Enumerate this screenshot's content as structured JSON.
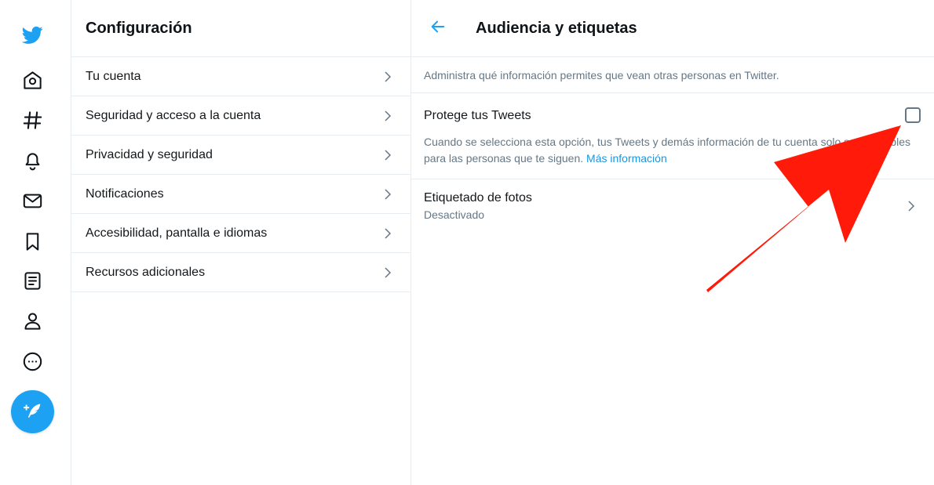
{
  "nav": {
    "icons": [
      "twitter-bird-icon",
      "home-icon",
      "explore-hashtag-icon",
      "notifications-bell-icon",
      "messages-envelope-icon",
      "bookmarks-icon",
      "lists-icon",
      "profile-person-icon",
      "more-options-icon"
    ],
    "tweet_button_icon": "compose-feather-icon",
    "brand_color": "#1da1f2"
  },
  "settings": {
    "title": "Configuración",
    "items": [
      {
        "label": "Tu cuenta"
      },
      {
        "label": "Seguridad y acceso a la cuenta"
      },
      {
        "label": "Privacidad y seguridad"
      },
      {
        "label": "Notificaciones"
      },
      {
        "label": "Accesibilidad, pantalla e idiomas"
      },
      {
        "label": "Recursos adicionales"
      }
    ]
  },
  "detail": {
    "title": "Audiencia y etiquetas",
    "description": "Administra qué información permites que vean otras personas en Twitter.",
    "protect": {
      "title": "Protege tus Tweets",
      "checked": false,
      "description": "Cuando se selecciona esta opción, tus Tweets y demás información de tu cuenta solo serán visibles para las personas que te siguen.",
      "link": "Más información"
    },
    "photo_tagging": {
      "title": "Etiquetado de fotos",
      "status": "Desactivado"
    }
  },
  "annotation": {
    "color": "#ff1a0a"
  }
}
